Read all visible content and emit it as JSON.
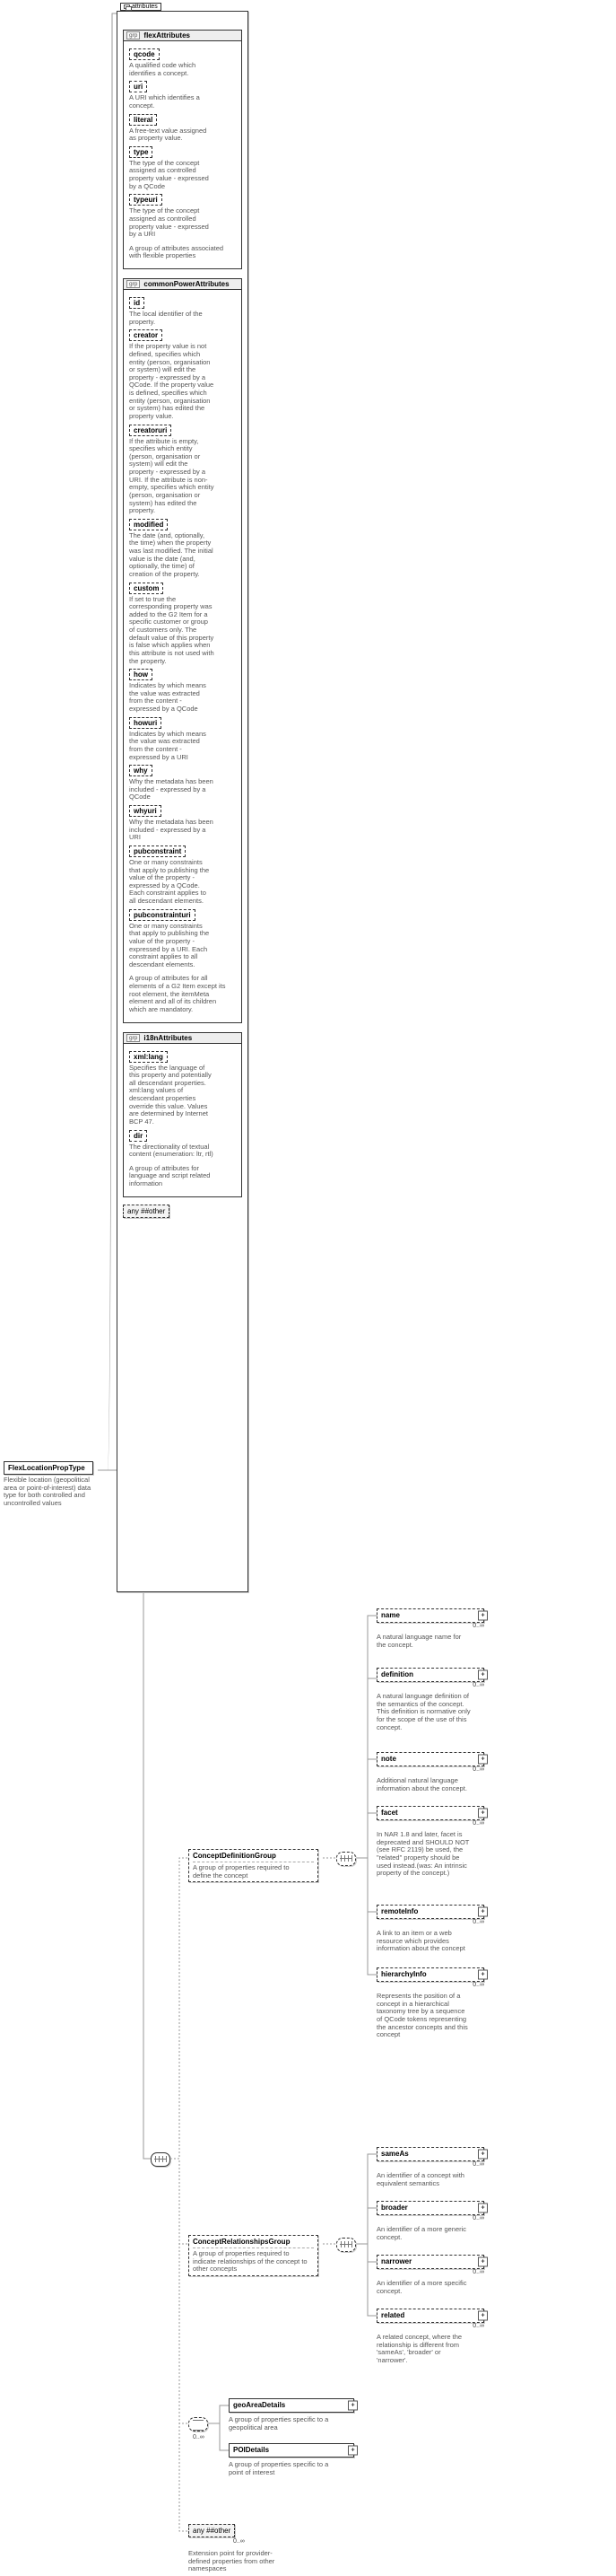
{
  "root": {
    "name": "FlexLocationPropType",
    "desc": "Flexible location (geopolitical area or point-of-interest) data type for both controlled and uncontrolled values"
  },
  "attributes_tab": "attributes",
  "grp_label": "grp",
  "plus": "+",
  "minus": "−",
  "flexAttributes": {
    "title": "flexAttributes",
    "items": [
      {
        "name": "qcode",
        "desc": "A qualified code which identifies a concept."
      },
      {
        "name": "uri",
        "desc": "A URI which identifies a concept."
      },
      {
        "name": "literal",
        "desc": "A free-text value assigned as property value."
      },
      {
        "name": "type",
        "desc": "The type of the concept assigned as controlled property value - expressed by a QCode"
      },
      {
        "name": "typeuri",
        "desc": "The type of the concept assigned as controlled property value - expressed by a URI"
      }
    ],
    "desc": "A group of attributes associated with flexible properties"
  },
  "commonPowerAttributes": {
    "title": "commonPowerAttributes",
    "items": [
      {
        "name": "id",
        "desc": "The local identifier of the property."
      },
      {
        "name": "creator",
        "desc": "If the property value is not defined, specifies which entity (person, organisation or system) will edit the property - expressed by a QCode. If the property value is defined, specifies which entity (person, organisation or system) has edited the property value."
      },
      {
        "name": "creatoruri",
        "desc": "If the attribute is empty, specifies which entity (person, organisation or system) will edit the property - expressed by a URI. If the attribute is non-empty, specifies which entity (person, organisation or system) has edited the property."
      },
      {
        "name": "modified",
        "desc": "The date (and, optionally, the time) when the property was last modified. The initial value is the date (and, optionally, the time) of creation of the property."
      },
      {
        "name": "custom",
        "desc": "If set to true the corresponding property was added to the G2 Item for a specific customer or group of customers only. The default value of this property is false which applies when this attribute is not used with the property."
      },
      {
        "name": "how",
        "desc": "Indicates by which means the value was extracted from the content - expressed by a QCode"
      },
      {
        "name": "howuri",
        "desc": "Indicates by which means the value was extracted from the content - expressed by a URI"
      },
      {
        "name": "why",
        "desc": "Why the metadata has been included - expressed by a QCode"
      },
      {
        "name": "whyuri",
        "desc": "Why the metadata has been included - expressed by a URI"
      },
      {
        "name": "pubconstraint",
        "desc": "One or many constraints that apply to publishing the value of the property - expressed by a QCode. Each constraint applies to all descendant elements."
      },
      {
        "name": "pubconstrainturi",
        "desc": "One or many constraints that apply to publishing the value of the property - expressed by a URI. Each constraint applies to all descendant elements."
      }
    ],
    "desc": "A group of attributes for all elements of a G2 Item except its root element, the itemMeta element and all of its children which are mandatory."
  },
  "i18nAttributes": {
    "title": "i18nAttributes",
    "items": [
      {
        "name": "xml:lang",
        "desc": "Specifies the language of this property and potentially all descendant properties. xml:lang values of descendant properties override this value. Values are determined by Internet BCP 47."
      },
      {
        "name": "dir",
        "desc": "The directionality of textual content (enumeration: ltr, rtl)"
      }
    ],
    "desc": "A group of attributes for language and script related information"
  },
  "anyAttr": {
    "label": "any ##other"
  },
  "conceptDefinitionGroup": {
    "title": "ConceptDefinitionGroup",
    "desc": "A group of properties required to define the concept",
    "items": [
      {
        "name": "name",
        "desc": "A natural language name for the concept."
      },
      {
        "name": "definition",
        "desc": "A natural language definition of the semantics of the concept. This definition is normative only for the scope of the use of this concept."
      },
      {
        "name": "note",
        "desc": "Additional natural language information about the concept."
      },
      {
        "name": "facet",
        "desc": "In NAR 1.8 and later, facet is deprecated and SHOULD NOT (see RFC 2119) be used, the \"related\" property should be used instead.(was: An intrinsic property of the concept.)"
      },
      {
        "name": "remoteInfo",
        "desc": "A link to an item or a web resource which provides information about the concept"
      },
      {
        "name": "hierarchyInfo",
        "desc": "Represents the position of a concept in a hierarchical taxonomy tree by a sequence of QCode tokens representing the ancestor concepts and this concept"
      }
    ]
  },
  "conceptRelationshipsGroup": {
    "title": "ConceptRelationshipsGroup",
    "desc": "A group of properties required to indicate relationships of the concept to other concepts",
    "items": [
      {
        "name": "sameAs",
        "desc": "An identifier of a concept with equivalent semantics"
      },
      {
        "name": "broader",
        "desc": "An identifier of a more generic concept."
      },
      {
        "name": "narrower",
        "desc": "An identifier of a more specific concept."
      },
      {
        "name": "related",
        "desc": "A related concept, where the relationship is different from 'sameAs', 'broader' or 'narrower'."
      }
    ]
  },
  "geoArea": {
    "name": "geoAreaDetails",
    "desc": "A group of properties specific to a geopolitical area"
  },
  "poi": {
    "name": "POIDetails",
    "desc": "A group of properties specific to a point of interest"
  },
  "anyElem": {
    "label": "any ##other",
    "desc": "Extension point for provider-defined properties from other namespaces"
  },
  "occ_unbounded": "0..∞"
}
